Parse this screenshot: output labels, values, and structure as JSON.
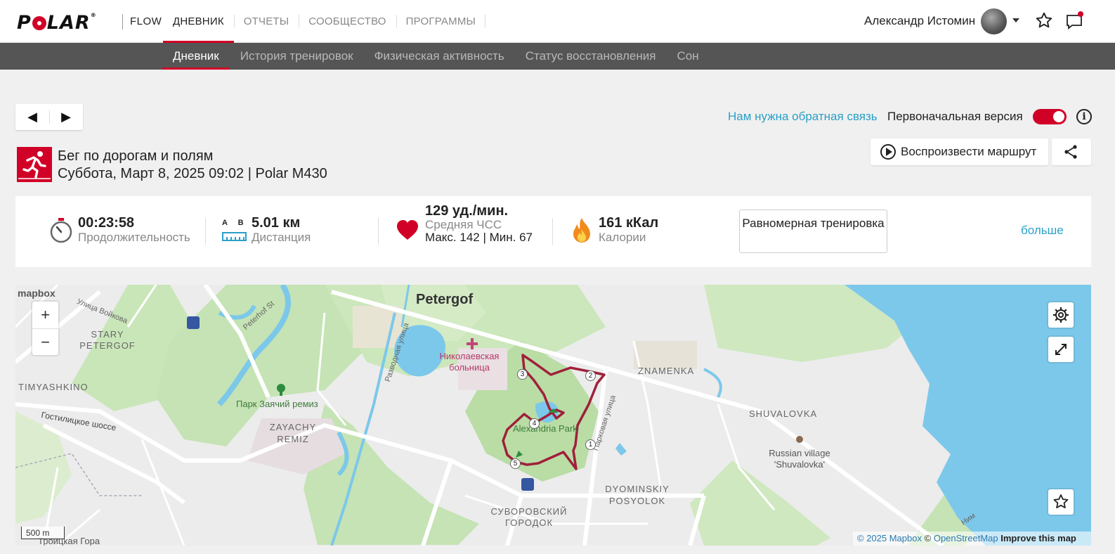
{
  "brand": {
    "logo_left": "P",
    "logo_right": "LAR",
    "reg": "®",
    "product": "FLOW"
  },
  "topnav": {
    "items": [
      "ДНЕВНИК",
      "ОТЧЕТЫ",
      "СООБЩЕСТВО",
      "ПРОГРАММЫ"
    ],
    "active": 0
  },
  "user": {
    "name": "Александр Истомин"
  },
  "subnav": {
    "items": [
      "Дневник",
      "История тренировок",
      "Физическая активность",
      "Статус восстановления",
      "Сон"
    ],
    "active": 0
  },
  "pager": {
    "prev": "◀",
    "next": "▶"
  },
  "feedback_link": "Нам нужна обратная связь",
  "original_version": {
    "label": "Первоначальная версия",
    "enabled": true
  },
  "info_label": "i",
  "activity": {
    "sport": "Бег по дорогам и полям",
    "date_line": "Суббота, Март 8, 2025 09:02 | Polar M430",
    "play_route": "Воспроизвести маршрут"
  },
  "stats": {
    "duration": {
      "value": "00:23:58",
      "label": "Продолжительность"
    },
    "distance": {
      "value": "5.01 км",
      "label": "Дистанция",
      "ab": "A B"
    },
    "heart_rate": {
      "value": "129 уд./мин.",
      "label": "Средняя ЧСС",
      "minmax": "Макс. 142  |  Мин. 67"
    },
    "calories": {
      "value": "161 кКал",
      "label": "Калории"
    },
    "training_type": "Равномерная тренировка",
    "more": "больше"
  },
  "map": {
    "labels": {
      "petergof": "Petergof",
      "stary": "STARY PETERGOF",
      "timyashkino": "TIMYASHKINO",
      "park": "Парк Заячий ремиз",
      "zayachy": "ZAYACHY REMIZ",
      "hospital": "Николаевская больница",
      "alexandria": "Alexandria Park",
      "znamenka": "ZNAMENKA",
      "shuvalovka": "SHUVALOVKA",
      "russian_village": "Russian village 'Shuvalovka'",
      "dyominskiy": "DYOMINSKIY POSYOLOK",
      "suvorovsky": "СУВОРОВСКИЙ ГОРОДОК",
      "troitskaya": "Троицкая Гора",
      "ul_voykova": "Улица Войкова",
      "peterhof_st": "Peterhof St",
      "razvodnaya": "Разводная улица",
      "parkovaya": "Парковая улица",
      "gostilitskoe": "Гостилицкое шоссе",
      "nim": "Ним"
    },
    "laps": [
      "1",
      "2",
      "3",
      "4",
      "5"
    ],
    "mapbox": "mapbox",
    "scale": "500 m",
    "zoom_in": "+",
    "zoom_out": "−",
    "attribution": {
      "mapbox": "© 2025 Mapbox",
      "osm_prefix": "©",
      "osm": "OpenStreetMap",
      "improve": "Improve this map"
    }
  },
  "colors": {
    "accent": "#d10027",
    "link": "#2aa0c8",
    "water": "#7cc8ea",
    "park": "#c5e3b4",
    "route": "#a0203b"
  }
}
